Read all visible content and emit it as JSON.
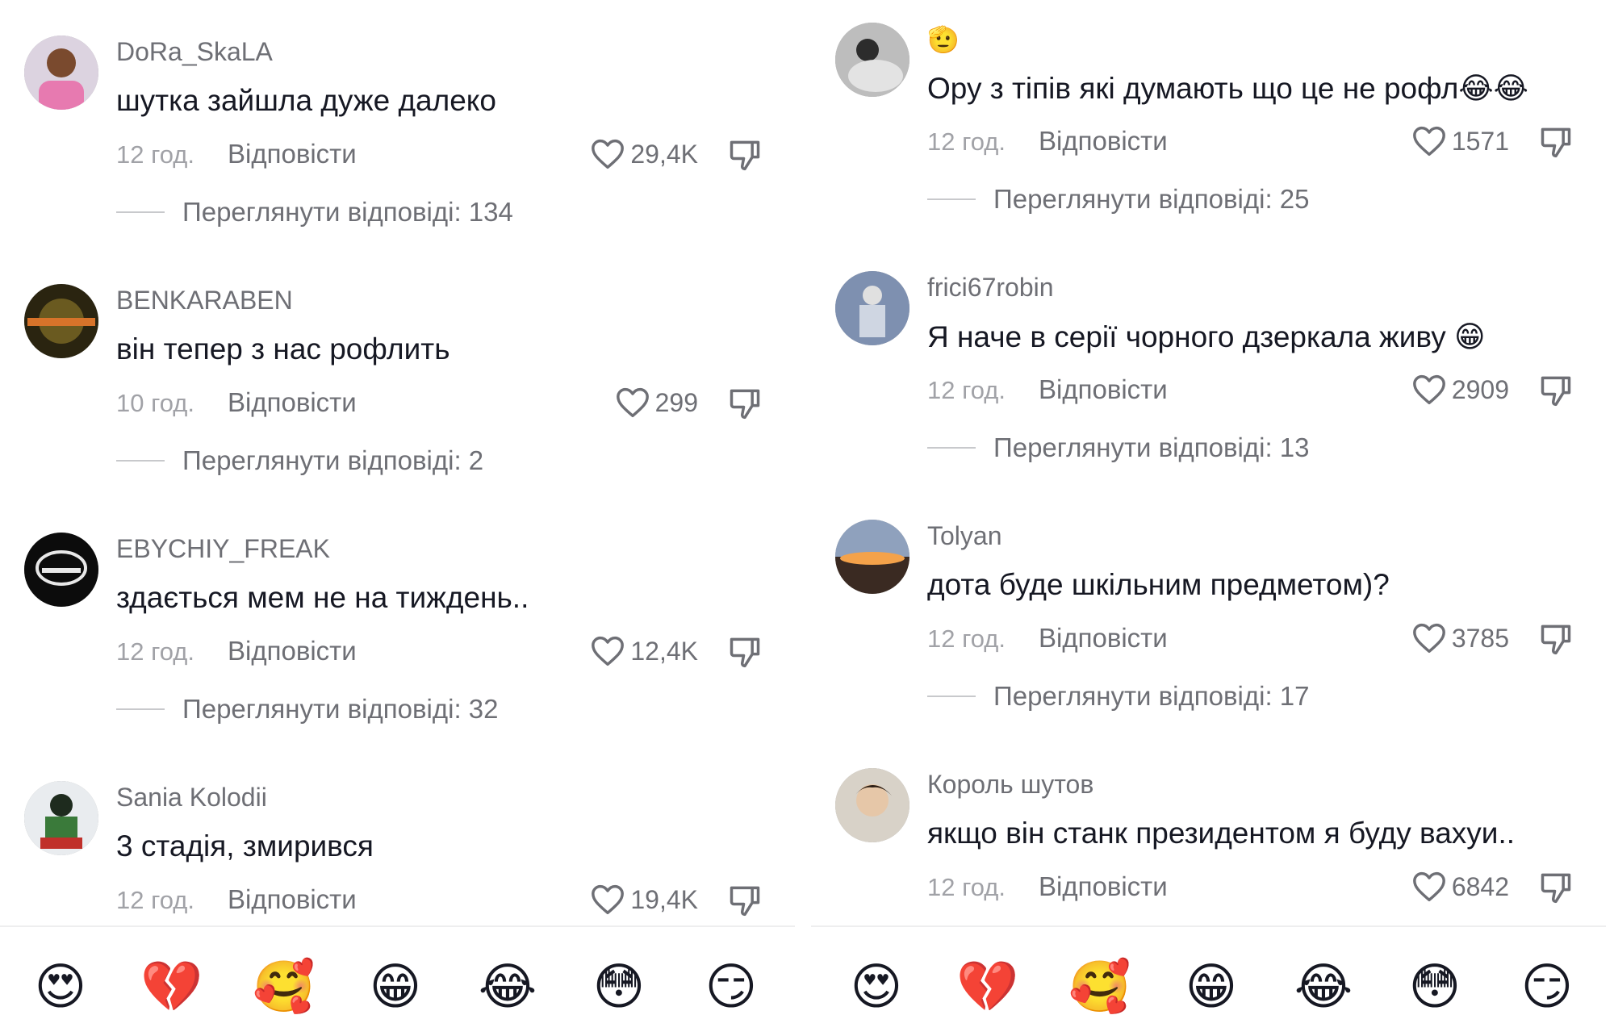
{
  "left": {
    "comments": [
      {
        "username": "DoRa_SkaLA",
        "text": "шутка зайшла дуже далеко",
        "time": "12 год.",
        "reply": "Відповісти",
        "likes": "29,4K",
        "view_replies": "Переглянути відповіді: 134"
      },
      {
        "username": "BENKARABEN",
        "text": "він тепер з нас рофлить",
        "time": "10 год.",
        "reply": "Відповісти",
        "likes": "299",
        "view_replies": "Переглянути відповіді: 2"
      },
      {
        "username": "EBYCHIY_FREAK",
        "text": "здається мем не на тиждень..",
        "time": "12 год.",
        "reply": "Відповісти",
        "likes": "12,4K",
        "view_replies": "Переглянути відповіді: 32"
      },
      {
        "username": "Sania Kolodii",
        "text": "3 стадія, змирився",
        "time": "12 год.",
        "reply": "Відповісти",
        "likes": "19,4K"
      }
    ]
  },
  "right": {
    "comments": [
      {
        "username": "🫡",
        "text": "Ору з тіпів які думають що це не рофл😂😂",
        "time": "12 год.",
        "reply": "Відповісти",
        "likes": "1571",
        "view_replies": "Переглянути відповіді: 25"
      },
      {
        "username": "frici67robin",
        "text": "Я наче в серії чорного дзеркала живу 😁",
        "time": "12 год.",
        "reply": "Відповісти",
        "likes": "2909",
        "view_replies": "Переглянути відповіді: 13"
      },
      {
        "username": "Tolyan",
        "text": "дота буде шкільним предметом)?",
        "time": "12 год.",
        "reply": "Відповісти",
        "likes": "3785",
        "view_replies": "Переглянути відповіді: 17"
      },
      {
        "username": "Король шутов",
        "text": "якщо він станк президентом я буду вахуи..",
        "time": "12 год.",
        "reply": "Відповісти",
        "likes": "6842"
      }
    ]
  },
  "emoji_bar": [
    "😍",
    "💔",
    "🥰",
    "😁",
    "😂",
    "😳",
    "😏"
  ],
  "icons": {
    "like": "heart-outline-icon",
    "dislike": "thumbs-down-outline-icon"
  },
  "colors": {
    "text": "#161823",
    "secondary": "#6e6f75",
    "muted": "#a1a2a7"
  }
}
